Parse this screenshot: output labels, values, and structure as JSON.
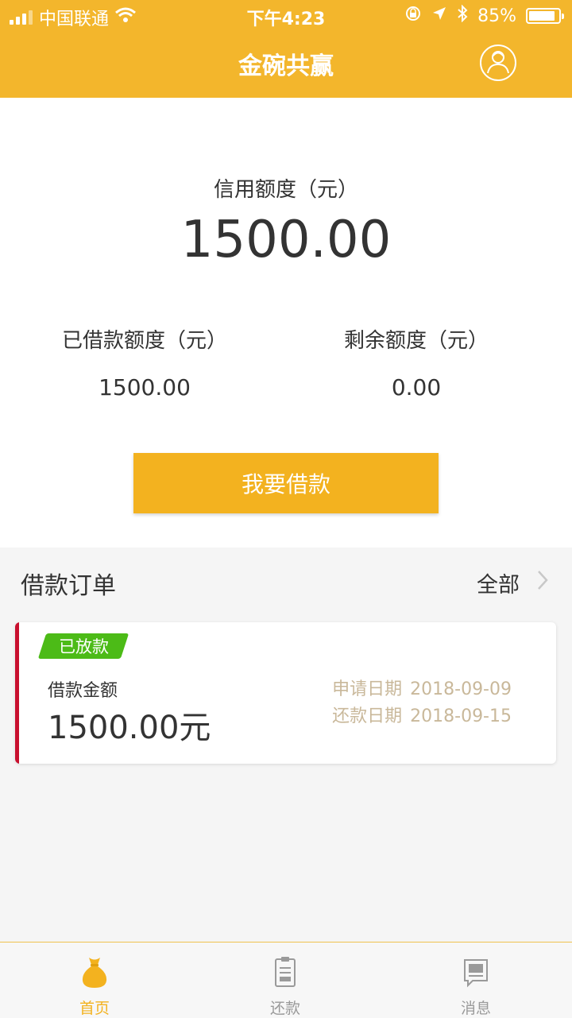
{
  "status_bar": {
    "carrier": "中国联通",
    "time": "下午4:23",
    "battery": "85%"
  },
  "header": {
    "title": "金碗共赢"
  },
  "summary": {
    "credit_label": "信用额度（元）",
    "credit_value": "1500.00",
    "borrowed_label": "已借款额度（元）",
    "borrowed_value": "1500.00",
    "remaining_label": "剩余额度（元）",
    "remaining_value": "0.00",
    "borrow_button": "我要借款"
  },
  "orders": {
    "title": "借款订单",
    "all_label": "全部",
    "items": [
      {
        "status": "已放款",
        "amount_label": "借款金额",
        "amount": "1500.00元",
        "apply_date_label": "申请日期",
        "apply_date": "2018-09-09",
        "repay_date_label": "还款日期",
        "repay_date": "2018-09-15"
      }
    ]
  },
  "tabbar": {
    "home": "首页",
    "repay": "还款",
    "messages": "消息"
  },
  "colors": {
    "brand": "#f3b62c",
    "button": "#f3b21f",
    "status_badge": "#4cbb17",
    "card_accent": "#c8102e",
    "date_text": "#c9b89a"
  },
  "icons": {
    "profile": "user-profile-icon",
    "chevron": "chevron-right-icon",
    "home": "money-bag-icon",
    "repay": "clipboard-icon",
    "messages": "message-icon"
  }
}
